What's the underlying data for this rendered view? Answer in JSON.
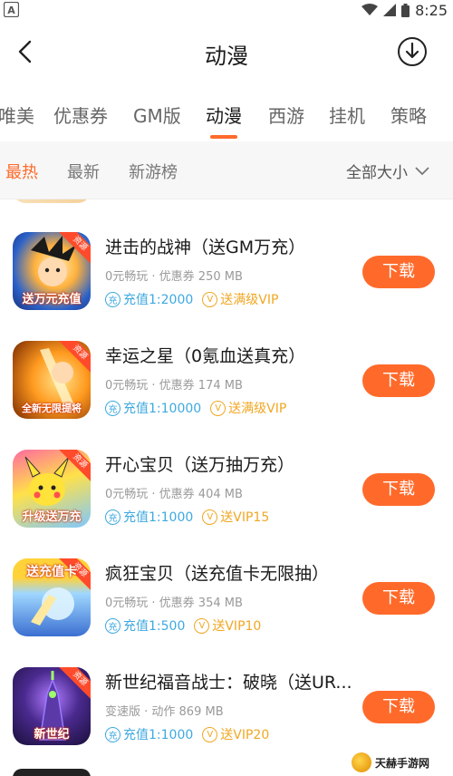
{
  "status": {
    "time": "8:25"
  },
  "header": {
    "title": "动漫"
  },
  "categories": [
    {
      "label": "唯美"
    },
    {
      "label": "优惠券"
    },
    {
      "label": "GM版"
    },
    {
      "label": "动漫"
    },
    {
      "label": "西游"
    },
    {
      "label": "挂机"
    },
    {
      "label": "策略"
    }
  ],
  "sort": {
    "items": [
      {
        "label": "最热"
      },
      {
        "label": "最新"
      },
      {
        "label": "新游榜"
      }
    ],
    "size_filter": "全部大小"
  },
  "games": [
    {
      "name": "进击的战神（送GM万充）",
      "meta": "0元畅玩 · 优惠券   250 MB",
      "recharge": "充值1:2000",
      "vip": "送满级VIP",
      "download": "下载",
      "icon_caption": "送万元充值",
      "icon_badge": "资源"
    },
    {
      "name": "幸运之星（0氪血送真充）",
      "meta": "0元畅玩 · 优惠券   174 MB",
      "recharge": "充值1:10000",
      "vip": "送满级VIP",
      "download": "下载",
      "icon_caption": "全新无限提将",
      "icon_badge": "资源"
    },
    {
      "name": "开心宝贝（送万抽万充）",
      "meta": "0元畅玩 · 优惠券   404 MB",
      "recharge": "充值1:1000",
      "vip": "送VIP15",
      "download": "下载",
      "icon_caption": "升级送万充",
      "icon_badge": "资源"
    },
    {
      "name": "疯狂宝贝（送充值卡无限抽）",
      "meta": "0元畅玩 · 优惠券   354 MB",
      "recharge": "充值1:500",
      "vip": "送VIP10",
      "download": "下载",
      "icon_caption": "送充值卡",
      "icon_badge": "资源"
    },
    {
      "name": "新世纪福音战士：破晓（送UR...",
      "meta": "变速版 · 动作   869 MB",
      "recharge": "充值1:1000",
      "vip": "送VIP20",
      "download": "下载",
      "icon_caption": "新世纪",
      "icon_badge": "资源"
    }
  ],
  "watermark": {
    "text": "天赫手游网"
  },
  "colors": {
    "accent": "#ff6a2b",
    "recharge_blue": "#3ea9e0",
    "vip_gold": "#f0a723"
  }
}
